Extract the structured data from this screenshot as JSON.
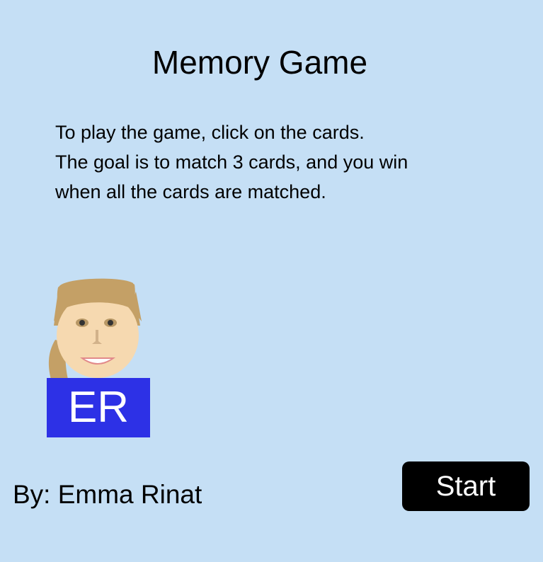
{
  "game": {
    "title": "Memory Game",
    "instructions": [
      "To play the game, click on the cards.",
      "The goal is to match 3 cards, and you win",
      "when all the cards are matched."
    ],
    "avatar": {
      "icon": "girl-face-icon",
      "initials": "ER"
    },
    "author": "By: Emma Rinat",
    "start_label": "Start"
  },
  "colors": {
    "background": "#c5dff5",
    "badge": "#2d31e6",
    "button": "#000000",
    "button_text": "#ffffff"
  }
}
